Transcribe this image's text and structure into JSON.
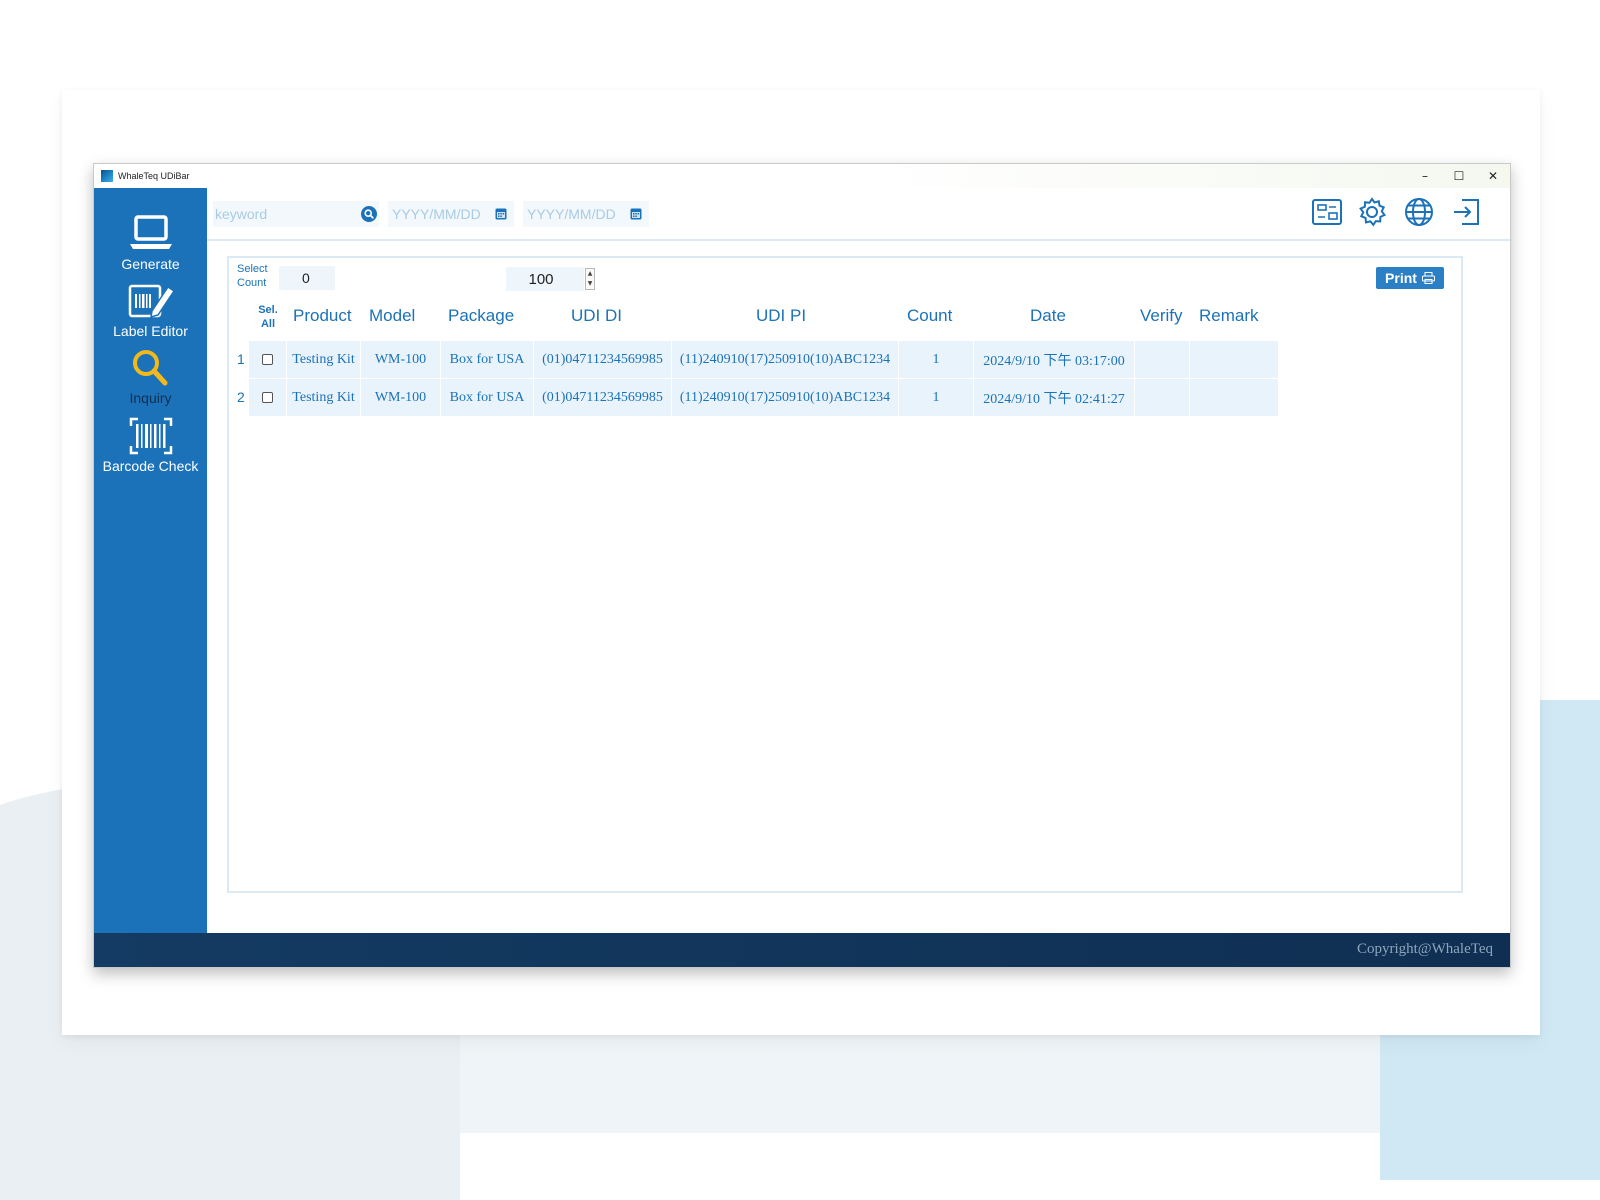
{
  "window": {
    "title": "WhaleTeq UDiBar",
    "controls": [
      "–",
      "☐",
      "✕"
    ]
  },
  "sidebar": {
    "items": [
      {
        "label": "Generate",
        "icon": "laptop-icon"
      },
      {
        "label": "Label Editor",
        "icon": "label-edit-icon"
      },
      {
        "label": "Inquiry",
        "icon": "magnifier-icon"
      },
      {
        "label": "Barcode Check",
        "icon": "barcode-scan-icon"
      }
    ]
  },
  "toolbar": {
    "keyword_placeholder": "keyword",
    "date_from_placeholder": "YYYY/MM/DD",
    "date_to_placeholder": "YYYY/MM/DD",
    "icons": [
      "label-template-icon",
      "settings-gear-icon",
      "language-globe-icon",
      "logout-icon"
    ]
  },
  "panel": {
    "select_label_line1": "Select",
    "select_label_line2": "Count",
    "select_count": "0",
    "page_size": "100",
    "print_label": "Print"
  },
  "table": {
    "sel_all_line1": "Sel.",
    "sel_all_line2": "All",
    "columns": [
      "Product",
      "Model",
      "Package",
      "UDI DI",
      "UDI PI",
      "Count",
      "Date",
      "Verify",
      "Remark"
    ],
    "rows": [
      {
        "no": "1",
        "product": "Testing Kit",
        "model": "WM-100",
        "package": "Box for USA",
        "udi_di": "(01)04711234569985",
        "udi_pi": "(11)240910(17)250910(10)ABC1234",
        "count": "1",
        "date": "2024/9/10 下午 03:17:00",
        "verify": "",
        "remark": ""
      },
      {
        "no": "2",
        "product": "Testing Kit",
        "model": "WM-100",
        "package": "Box for USA",
        "udi_di": "(01)04711234569985",
        "udi_pi": "(11)240910(17)250910(10)ABC1234",
        "count": "1",
        "date": "2024/9/10 下午 02:41:27",
        "verify": "",
        "remark": ""
      }
    ]
  },
  "footer": {
    "copyright": "Copyright@WhaleTeq"
  },
  "colors": {
    "primary": "#1c72b8",
    "row_bg": "#e9f3fc",
    "footer_bg": "#0f2f52",
    "icon_yellow": "#f3b81b"
  }
}
